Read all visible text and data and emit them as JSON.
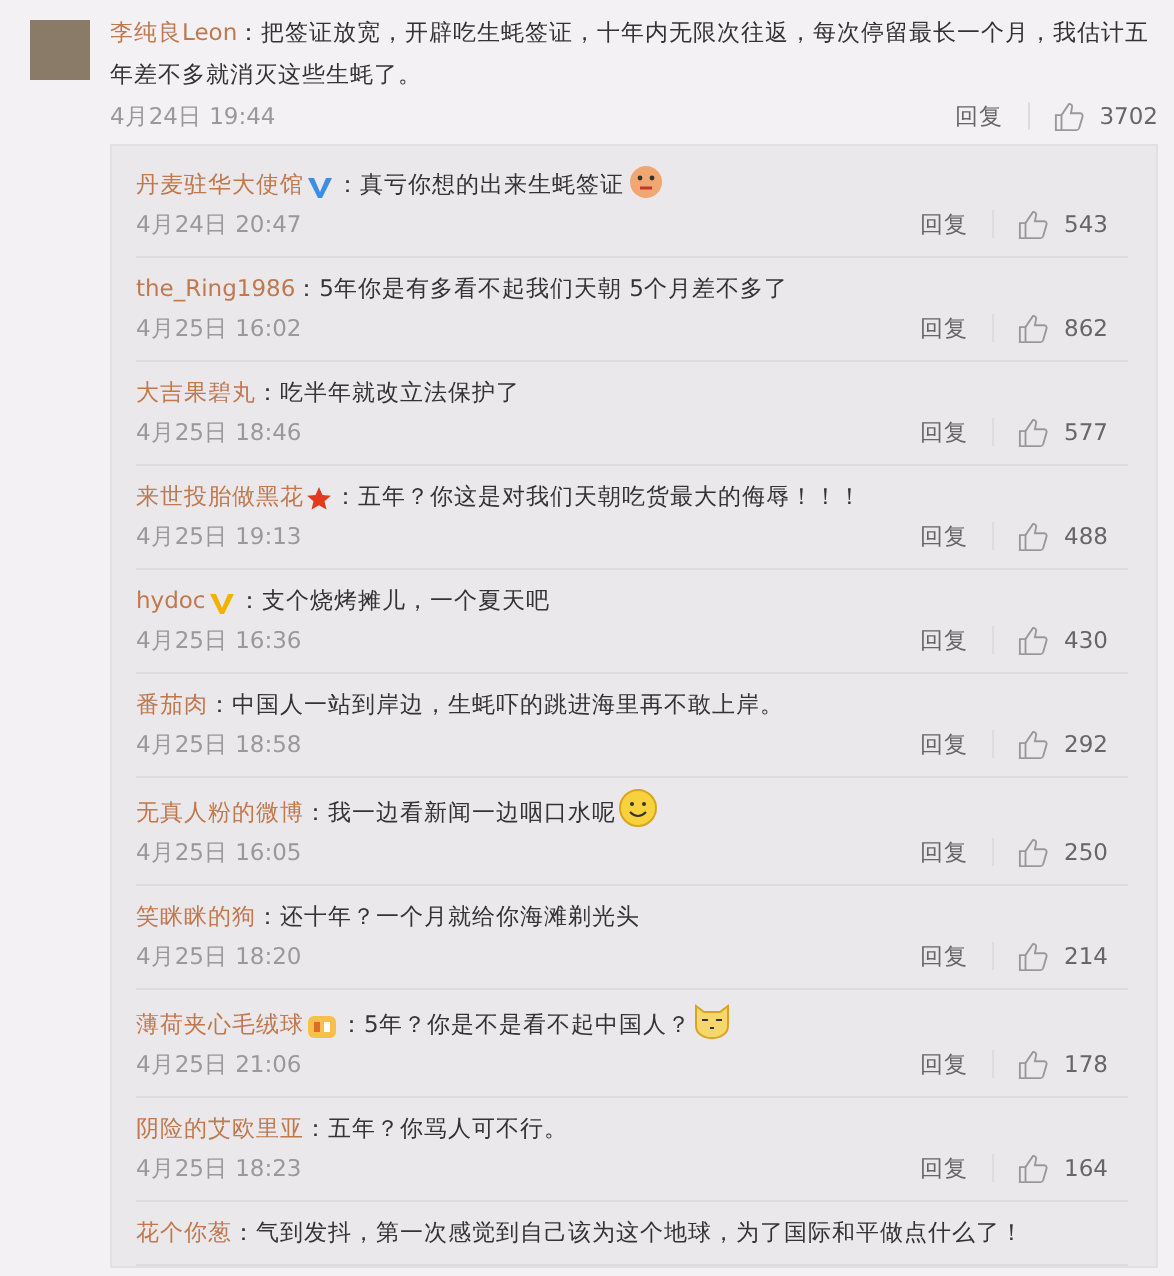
{
  "comment": {
    "author": "李纯良Leon",
    "text_lines": [
      "：把签证放宽，开辟吃生蚝签证，十年内无限次往返，每次停留最长一个月，我估计五",
      "年差不多就消灭这些生蚝了。"
    ],
    "time": "4月24日 19:44",
    "reply_label": "回复",
    "likes": "3702"
  },
  "replies": [
    {
      "author": "丹麦驻华大使馆",
      "badge": {
        "kind": "verified-blue"
      },
      "text": "：真亏你想的出来生蚝签证",
      "emoji": {
        "kind": "chick"
      },
      "time": "4月24日 20:47",
      "reply_label": "回复",
      "likes": "543"
    },
    {
      "author": "the_Ring1986",
      "text": "：5年你是有多看不起我们天朝 5个月差不多了",
      "time": "4月25日 16:02",
      "reply_label": "回复",
      "likes": "862"
    },
    {
      "author": "大吉果碧丸",
      "text": "：吃半年就改立法保护了",
      "time": "4月25日 18:46",
      "reply_label": "回复",
      "likes": "577"
    },
    {
      "author": "来世投胎做黑花",
      "badge": {
        "kind": "star"
      },
      "text": "：五年？你这是对我们天朝吃货最大的侮辱！！！",
      "time": "4月25日 19:13",
      "reply_label": "回复",
      "likes": "488"
    },
    {
      "author": "hydoc",
      "badge": {
        "kind": "verified-gold"
      },
      "text": "：支个烧烤摊儿，一个夏天吧",
      "time": "4月25日 16:36",
      "reply_label": "回复",
      "likes": "430"
    },
    {
      "author": "番茄肉",
      "text": "：中国人一站到岸边，生蚝吓的跳进海里再不敢上岸。",
      "time": "4月25日 18:58",
      "reply_label": "回复",
      "likes": "292"
    },
    {
      "author": "无真人粉的微博",
      "text": "：我一边看新闻一边咽口水呢",
      "emoji": {
        "kind": "smile"
      },
      "time": "4月25日 16:05",
      "reply_label": "回复",
      "likes": "250"
    },
    {
      "author": "笑眯眯的狗",
      "text": "：还十年？一个月就给你海滩剃光头",
      "time": "4月25日 18:20",
      "reply_label": "回复",
      "likes": "214"
    },
    {
      "author": "薄荷夹心毛绒球",
      "badge": {
        "kind": "vip"
      },
      "text": "：5年？你是不是看不起中国人？",
      "emoji": {
        "kind": "cat"
      },
      "time": "4月25日 21:06",
      "reply_label": "回复",
      "likes": "178"
    },
    {
      "author": "阴险的艾欧里亚",
      "text": "：五年？你骂人可不行。",
      "time": "4月25日 18:23",
      "reply_label": "回复",
      "likes": "164"
    },
    {
      "author": "花个你葱",
      "text": "：气到发抖，第一次感觉到自己该为这个地球，为了国际和平做点什么了！"
    }
  ]
}
